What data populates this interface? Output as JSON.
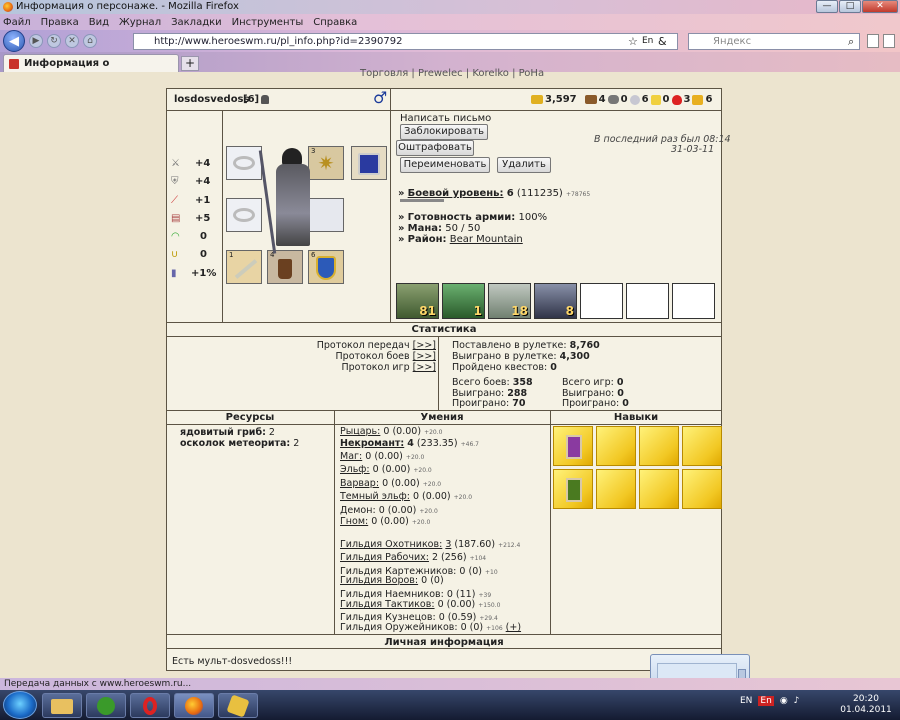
{
  "window": {
    "title": "Информация о персонаже. - Mozilla Firefox",
    "min": "—",
    "max": "□",
    "close": "✕"
  },
  "menu": [
    "Файл",
    "Правка",
    "Вид",
    "Журнал",
    "Закладки",
    "Инструменты",
    "Справка"
  ],
  "nav": {
    "url": "http://www.heroeswm.ru/pl_info.php?id=2390792",
    "search_placeholder": "Яндекс",
    "lang": "En",
    "amp": "&"
  },
  "tab": {
    "label": "Информация о персонаже.",
    "newtab": "+"
  },
  "topnav": "Торговля | Prewelec | Korelko | PoHa",
  "player": {
    "name": "losdosvedoss",
    "level": "[6]",
    "gender_symbol": "♂"
  },
  "resources_top": [
    {
      "icon": "gold-icon",
      "value": "3,597"
    },
    {
      "icon": "wood-icon",
      "value": "4"
    },
    {
      "icon": "ore-icon",
      "value": "0"
    },
    {
      "icon": "mercury-icon",
      "value": "6"
    },
    {
      "icon": "sulfur-icon",
      "value": "0"
    },
    {
      "icon": "crystal-icon",
      "value": "3"
    },
    {
      "icon": "gems-icon",
      "value": "6"
    }
  ],
  "stats": [
    {
      "icon": "sword-icon",
      "value": "+4"
    },
    {
      "icon": "shield-icon",
      "value": "+4"
    },
    {
      "icon": "wand-icon",
      "value": "+1"
    },
    {
      "icon": "book-icon",
      "value": "+5"
    },
    {
      "icon": "rainbow-icon",
      "value": "0"
    },
    {
      "icon": "horseshoe-icon",
      "value": "0"
    },
    {
      "icon": "vial-icon",
      "value": "+1%"
    }
  ],
  "equip_numbers": {
    "amulet": "3",
    "weapon": "1",
    "boots": "4",
    "shield": "6"
  },
  "actions": {
    "write_letter": "Написать письмо",
    "block": "Заблокировать",
    "fine": "Оштрафовать",
    "rename": "Переименовать",
    "delete": "Удалить"
  },
  "last_seen": {
    "line1": "В последний раз был 08:14",
    "line2": "31-03-11"
  },
  "combat": {
    "label": "Боевой уровень:",
    "level": "6",
    "exp": "(111235)",
    "extra": "+78765"
  },
  "army_ready": {
    "label": "Готовность армии:",
    "value": "100%"
  },
  "mana": {
    "label": "Мана:",
    "value": "50 / 50"
  },
  "district": {
    "label": "Район:",
    "value": "Bear Mountain"
  },
  "bullet": "»",
  "army": [
    {
      "count": "81"
    },
    {
      "count": "1"
    },
    {
      "count": "18"
    },
    {
      "count": "8"
    }
  ],
  "statistics": {
    "header": "Статистика",
    "protocols": [
      "Протокол передач",
      "Протокол боев",
      "Протокол игр"
    ],
    "link": "[>>]",
    "roulette_bet_label": "Поставлено в рулетке:",
    "roulette_bet": "8,760",
    "roulette_won_label": "Выиграно в рулетке:",
    "roulette_won": "4,300",
    "quests_label": "Пройдено квестов:",
    "quests": "0",
    "battles_label": "Всего боев:",
    "battles": "358",
    "won_label": "Выиграно:",
    "won": "288",
    "lost_label": "Проиграно:",
    "lost": "70",
    "games_label": "Всего игр:",
    "games": "0",
    "games_won": "0",
    "games_lost": "0"
  },
  "resources_header": "Ресурсы",
  "resources": [
    {
      "name": "ядовитый гриб:",
      "value": "2"
    },
    {
      "name": "осколок метеорита:",
      "value": "2"
    }
  ],
  "skills_header": "Умения",
  "factions": [
    {
      "name": "Рыцарь:",
      "value": "0 (0.00)",
      "extra": "+20.0"
    },
    {
      "name": "Некромант:",
      "value": "4",
      "paren": "(233.35)",
      "extra": "+46.7"
    },
    {
      "name": "Маг:",
      "value": "0 (0.00)",
      "extra": "+20.0"
    },
    {
      "name": "Эльф:",
      "value": "0 (0.00)",
      "extra": "+20.0"
    },
    {
      "name": "Варвар:",
      "value": "0 (0.00)",
      "extra": "+20.0"
    },
    {
      "name": "Темный эльф:",
      "value": "0 (0.00)",
      "extra": "+20.0"
    },
    {
      "name": "Демон:",
      "value": "0 (0.00)",
      "extra": "+20.0"
    },
    {
      "name": "Гном:",
      "value": "0 (0.00)",
      "extra": "+20.0"
    }
  ],
  "guilds": [
    {
      "name": "Гильдия Охотников:",
      "value": "3",
      "paren": "(187.60)",
      "extra": "+212.4"
    },
    {
      "name": "Гильдия Рабочих:",
      "value": "2 (256)",
      "extra": "+104"
    },
    {
      "name": "Гильдия Картежников:",
      "value": "0 (0)",
      "extra": "+10"
    },
    {
      "name": "Гильдия Воров:",
      "value": "0 (0)",
      "extra": ""
    },
    {
      "name": "Гильдия Наемников:",
      "value": "0 (11)",
      "extra": "+39"
    },
    {
      "name": "Гильдия Тактиков:",
      "value": "0 (0.00)",
      "extra": "+150.0"
    },
    {
      "name": "Гильдия Кузнецов:",
      "value": "0 (0.59)",
      "extra": "+29.4"
    },
    {
      "name": "Гильдия Оружейников:",
      "value": "0 (0)",
      "extra": "+106",
      "plus": "(+)"
    }
  ],
  "talents_header": "Навыки",
  "personal_header": "Личная информация",
  "personal_text": "Есть мульт-dosvedoss!!!",
  "status": "Передача данных с www.heroeswm.ru...",
  "taskbar": {
    "lang": "EN",
    "tray_lang": "En",
    "time": "20:20",
    "date": "01.04.2011"
  }
}
